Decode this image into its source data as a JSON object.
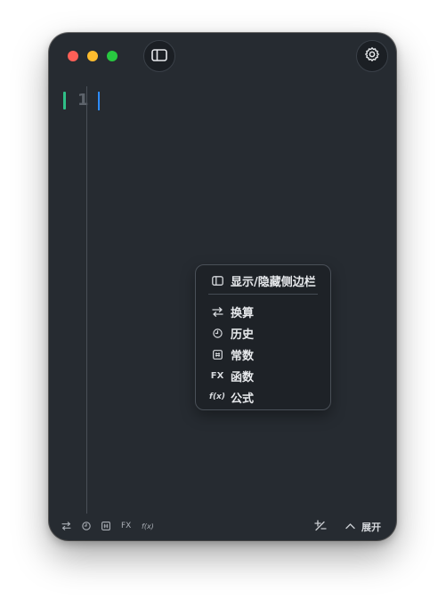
{
  "sidebar_toggle_tooltip": "",
  "editor": {
    "line_numbers": [
      "1"
    ]
  },
  "context_menu": {
    "items": [
      {
        "label": "显示/隐藏侧边栏",
        "icon": "sidebar-icon"
      },
      {
        "label": "换算",
        "icon": "swap-arrows-icon"
      },
      {
        "label": "历史",
        "icon": "clock-icon"
      },
      {
        "label": "常数",
        "icon": "hash-box-icon"
      },
      {
        "label": "函数",
        "icon": "fx-icon",
        "icon_text": "FX"
      },
      {
        "label": "公式",
        "icon": "f-of-x-icon",
        "icon_text": "f(x)"
      }
    ]
  },
  "bottom_bar": {
    "icons": [
      {
        "icon": "swap-arrows-icon"
      },
      {
        "icon": "clock-icon"
      },
      {
        "icon": "hash-box-icon"
      },
      {
        "icon": "fx-icon",
        "text": "FX"
      },
      {
        "icon": "f-of-x-icon",
        "text": "f(x)"
      }
    ],
    "plus_minus_icon": "plus-minus-icon",
    "expand_label": "展开"
  },
  "colors": {
    "window_bg": "#262b31",
    "line_marker": "#2fbf87",
    "caret": "#2d8cff",
    "close": "#fe5f57",
    "minimize": "#febc2e",
    "zoom": "#28c840"
  }
}
